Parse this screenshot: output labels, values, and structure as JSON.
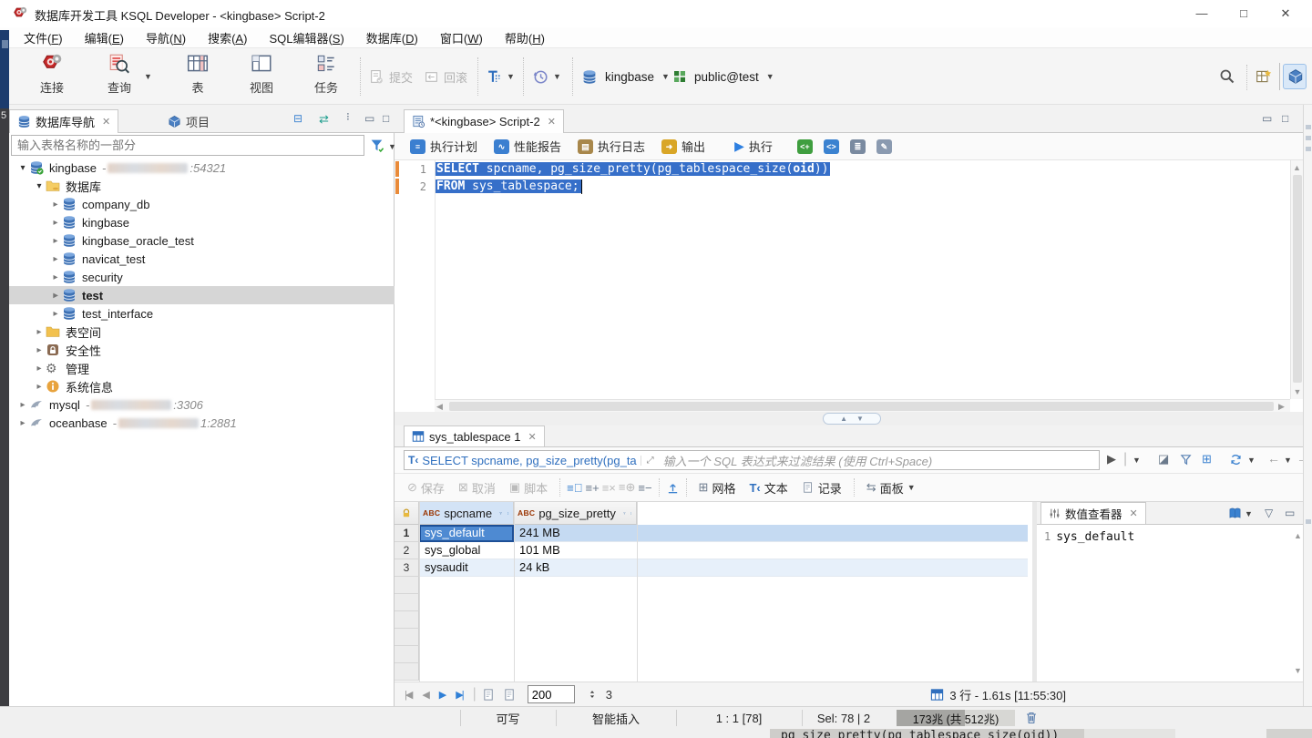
{
  "window": {
    "title": "数据库开发工具 KSQL Developer - <kingbase> Script-2",
    "controls": {
      "minimize": "—",
      "maximize": "□",
      "close": "✕"
    }
  },
  "menu": {
    "items": [
      "文件(F)",
      "编辑(E)",
      "导航(N)",
      "搜索(A)",
      "SQL编辑器(S)",
      "数据库(D)",
      "窗口(W)",
      "帮助(H)"
    ]
  },
  "toolbar": {
    "connect": "连接",
    "query": "查询",
    "table": "表",
    "view": "视图",
    "task": "任务",
    "commit": "提交",
    "rollback": "回滚",
    "db_selector": "kingbase",
    "schema_selector": "public@test"
  },
  "sidebar": {
    "tab_navigator": "数据库导航",
    "tab_project": "项目",
    "search_placeholder": "输入表格名称的一部分",
    "tree": [
      {
        "label": "kingbase",
        "host_suffix": ":54321",
        "icon": "database-connection",
        "level": 0,
        "expander": "open",
        "redacted": true
      },
      {
        "label": "数据库",
        "icon": "folder-database",
        "level": 1,
        "expander": "open"
      },
      {
        "label": "company_db",
        "icon": "database",
        "level": 2,
        "expander": "closed"
      },
      {
        "label": "kingbase",
        "icon": "database",
        "level": 2,
        "expander": "closed"
      },
      {
        "label": "kingbase_oracle_test",
        "icon": "database",
        "level": 2,
        "expander": "closed"
      },
      {
        "label": "navicat_test",
        "icon": "database",
        "level": 2,
        "expander": "closed"
      },
      {
        "label": "security",
        "icon": "database",
        "level": 2,
        "expander": "closed"
      },
      {
        "label": "test",
        "icon": "database",
        "level": 2,
        "expander": "closed",
        "selected": true
      },
      {
        "label": "test_interface",
        "icon": "database",
        "level": 2,
        "expander": "closed"
      },
      {
        "label": "表空间",
        "icon": "folder",
        "level": 1,
        "expander": "closed"
      },
      {
        "label": "安全性",
        "icon": "lock",
        "level": 1,
        "expander": "closed"
      },
      {
        "label": "管理",
        "icon": "gear",
        "level": 1,
        "expander": "closed"
      },
      {
        "label": "系统信息",
        "icon": "info",
        "level": 1,
        "expander": "closed"
      },
      {
        "label": "mysql",
        "host_suffix": ":3306",
        "icon": "dolphin",
        "level": 0,
        "expander": "closed",
        "redacted": true
      },
      {
        "label": "oceanbase",
        "host_suffix": "1:2881",
        "icon": "dolphin",
        "level": 0,
        "expander": "closed",
        "redacted": true
      }
    ]
  },
  "editor": {
    "tab": "*<kingbase> Script-2",
    "buttons": [
      "执行计划",
      "性能报告",
      "执行日志",
      "输出",
      "执行"
    ],
    "code": [
      {
        "num": "1",
        "tokens": [
          [
            "b",
            "SELECT"
          ],
          [
            "r",
            " spcname, pg_size_pretty(pg_tablespace_size("
          ],
          [
            "b",
            "oid"
          ],
          [
            "r",
            "))"
          ]
        ]
      },
      {
        "num": "2",
        "tokens": [
          [
            "b",
            "FROM"
          ],
          [
            "r",
            " sys_tablespace;"
          ]
        ]
      }
    ]
  },
  "results": {
    "tab": "sys_tablespace 1",
    "filter_history": "SELECT spcname, pg_size_pretty(pg_ta",
    "filter_placeholder": "输入一个 SQL 表达式来过滤结果 (使用 Ctrl+Space)",
    "toolbar": {
      "save": "保存",
      "cancel": "取消",
      "script": "脚本",
      "grid": "网格",
      "text": "文本",
      "record": "记录",
      "panel": "面板"
    },
    "grid": {
      "columns": [
        {
          "type": "ABC",
          "name": "spcname"
        },
        {
          "type": "ABC",
          "name": "pg_size_pretty"
        }
      ],
      "rows": [
        {
          "num": "1",
          "cells": [
            "sys_default",
            "241 MB"
          ],
          "state": "selected"
        },
        {
          "num": "2",
          "cells": [
            "sys_global",
            "101 MB"
          ],
          "state": "plain"
        },
        {
          "num": "3",
          "cells": [
            "sysaudit",
            "24 kB"
          ],
          "state": "striped"
        }
      ],
      "empty_rows": 6
    },
    "value_viewer": {
      "tab": "数值查看器",
      "line_num": "1",
      "value": "sys_default"
    },
    "fetch_size": "200",
    "fetch_count": "3",
    "rows_status": "3 行 - 1.61s [11:55:30]"
  },
  "statusbar": {
    "writable": "可写",
    "insert_mode": "智能插入",
    "position": "1 : 1 [78]",
    "selection": "Sel: 78 | 2",
    "memory": "173兆  (共 512兆)"
  },
  "artifacts": {
    "tooltip_fragment": "pg_size_pretty(pg_tablespace_size(oid))",
    "left_edge_digit": "5"
  },
  "colors": {
    "accent": "#366fc9",
    "selected_cell": "#4e8ad2",
    "row_highlight": "#c5daf2",
    "zebra": "#e7f0fa"
  }
}
